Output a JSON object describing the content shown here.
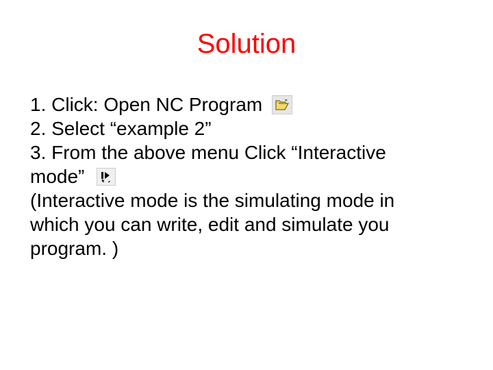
{
  "title": "Solution",
  "steps": {
    "s1": "1. Click: Open NC Program",
    "s2": "2. Select “example 2”",
    "s3a": "3. From the above menu Click “Interactive",
    "s3b": "mode”",
    "note1": "(Interactive mode is the simulating mode in",
    "note2": "which you can write, edit and simulate you",
    "note3": "program. )"
  },
  "icons": {
    "open_folder": "open-folder-icon",
    "interactive_mode": "interactive-mode-icon"
  }
}
